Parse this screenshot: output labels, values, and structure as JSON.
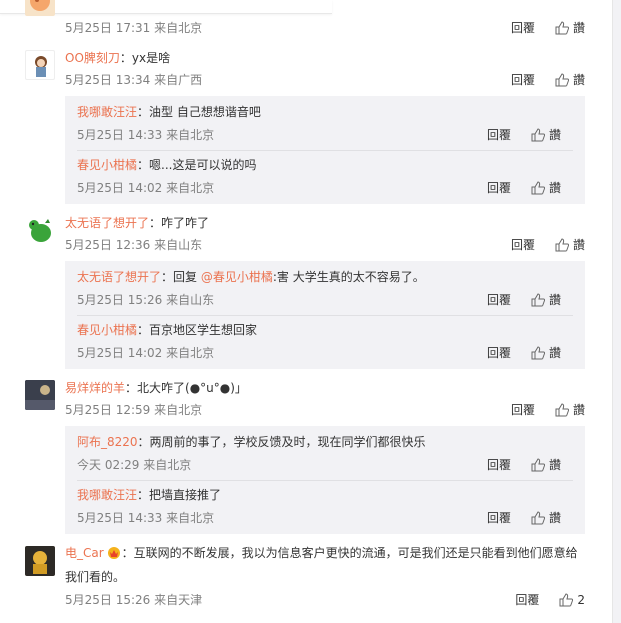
{
  "actions": {
    "reply": "回覆",
    "like": "讚"
  },
  "colors": {
    "username": "#eb7350",
    "meta": "#808080",
    "reply_bg": "#f2f2f5"
  },
  "comments": [
    {
      "meta": "5月25日 17:31 来自北京",
      "avatar_icon": "peach-avatar-partial"
    },
    {
      "user": "OO脾刻刀",
      "text": "：yx是啥",
      "meta": "5月25日 13:34 来自广西",
      "avatar_icon": "cartoon-boy-avatar",
      "replies": [
        {
          "user": "我哪敢汪汪",
          "text": "：油型 自己想想谐音吧",
          "meta": "5月25日 14:33 来自北京"
        },
        {
          "user": "春见小柑橘",
          "text": "：嗯...这是可以说的吗",
          "meta": "5月25日 14:02 来自北京"
        }
      ]
    },
    {
      "user": "太无语了想开了",
      "text": "：咋了咋了",
      "meta": "5月25日 12:36 来自山东",
      "avatar_icon": "green-dinosaur-avatar",
      "replies": [
        {
          "user": "太无语了想开了",
          "text_pre": "：回复 ",
          "mention": "@春见小柑橘",
          "text": ":害 大学生真的太不容易了。",
          "meta": "5月25日 15:26 来自山东"
        },
        {
          "user": "春见小柑橘",
          "text": "：百京地区学生想回家",
          "meta": "5月25日 14:02 来自北京"
        }
      ]
    },
    {
      "user": "易烊烊的羊",
      "text": "：北大咋了(●°u°●)」",
      "meta": "5月25日 12:59 来自北京",
      "avatar_icon": "dark-photo-avatar",
      "replies": [
        {
          "user": "阿布_8220",
          "text": "：两周前的事了，学校反馈及时，现在同学们都很快乐",
          "meta": "今天 02:29 来自北京"
        },
        {
          "user": "我哪敢汪汪",
          "text": "：把墙直接推了",
          "meta": "5月25日 14:33 来自北京"
        }
      ]
    },
    {
      "user": "电_Car",
      "text_line1": "：互联网的不断发展，我以为信息客户更快的流通，可是我们还是只能看到他们愿意给",
      "text_line2": "我们看的。",
      "meta": "5月25日 15:26 来自天津",
      "avatar_icon": "yellow-figure-avatar",
      "badge_icon": "vip-crown-badge-icon",
      "like_count": "2"
    }
  ]
}
